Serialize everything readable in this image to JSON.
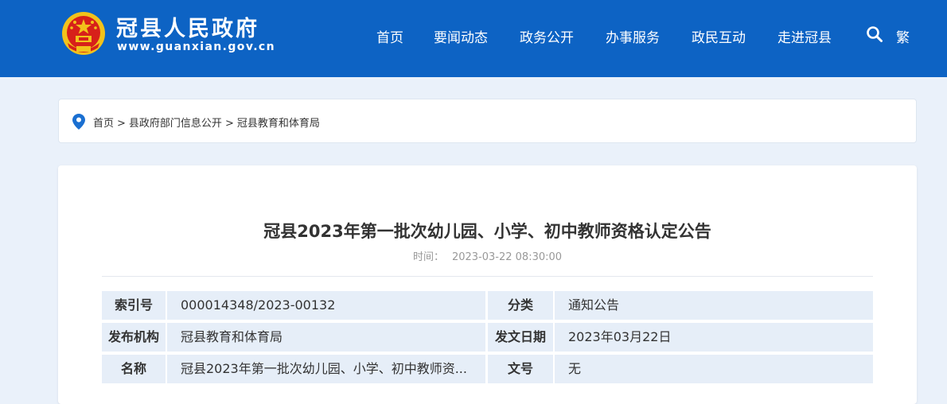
{
  "header": {
    "site_title": "冠县人民政府",
    "site_domain": "www.guanxian.gov.cn",
    "nav": [
      "首页",
      "要闻动态",
      "政务公开",
      "办事服务",
      "政民互动",
      "走进冠县"
    ],
    "traditional_label": "繁",
    "colors": {
      "header_bg": "#0d63c4",
      "emblem_red": "#d7201a",
      "emblem_gold": "#f2c21b"
    }
  },
  "breadcrumb": {
    "items": [
      "首页",
      "县政府部门信息公开",
      "冠县教育和体育局"
    ],
    "separator": ">"
  },
  "article": {
    "title": "冠县2023年第一批次幼儿园、小学、初中教师资格认定公告",
    "time_label": "时间：",
    "time_value": "2023-03-22 08:30:00",
    "meta": [
      {
        "l1": "索引号",
        "v1": "000014348/2023-00132",
        "l2": "分类",
        "v2": "通知公告"
      },
      {
        "l1": "发布机构",
        "v1": "冠县教育和体育局",
        "l2": "发文日期",
        "v2": "2023年03月22日"
      },
      {
        "l1": "名称",
        "v1": "冠县2023年第一批次幼儿园、小学、初中教师资...",
        "l2": "文号",
        "v2": "无"
      }
    ]
  }
}
